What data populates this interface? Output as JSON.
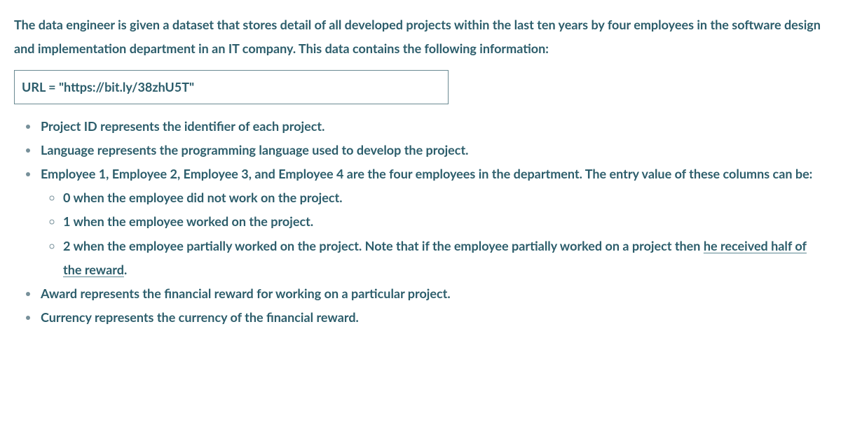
{
  "intro": "The data engineer is given a dataset that stores detail of all developed projects within the last ten years by four employees in the software design and implementation department in an IT company. This data contains the following information:",
  "url_line": "URL = \"https://bit.ly/38zhU5T\"",
  "bullets": {
    "b1": "Project ID represents the identifier of each project.",
    "b2": "Language represents the programming language used to develop the project.",
    "b3": "Employee 1, Employee 2, Employee 3, and Employee 4 are the four employees in the department. The entry value of these columns can be:",
    "b3_sub": {
      "s1": "0 when the employee did not work on the project.",
      "s2": "1 when the employee worked on the project.",
      "s3_pre": "2 when the employee partially worked on the project. Note that if the employee partially worked on a project then ",
      "s3_under": "he received half of the reward",
      "s3_post": "."
    },
    "b4": "Award represents the financial reward for working on a particular project.",
    "b5": "Currency represents the currency of the financial reward."
  }
}
